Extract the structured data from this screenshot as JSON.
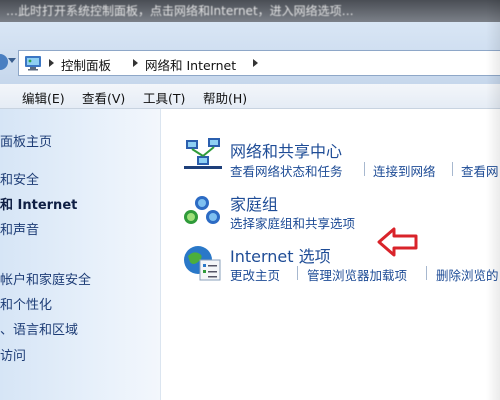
{
  "top_strip": {
    "text": "…此时打开系统控制面板，点击网络和Internet，进入网络选项…"
  },
  "address_bar": {
    "crumbs": [
      "控制面板",
      "网络和 Internet"
    ]
  },
  "menu": {
    "items": [
      "编辑(E)",
      "查看(V)",
      "工具(T)",
      "帮助(H)"
    ]
  },
  "left_nav": {
    "items": [
      "面板主页",
      "和安全",
      "和 Internet",
      "和声音",
      "帐户和家庭安全",
      "和个性化",
      "、语言和区域",
      "访问"
    ]
  },
  "categories": [
    {
      "title": "网络和共享中心",
      "links": [
        "查看网络状态和任务",
        "连接到网络",
        "查看网"
      ]
    },
    {
      "title": "家庭组",
      "links": [
        "选择家庭组和共享选项"
      ]
    },
    {
      "title": "Internet 选项",
      "links": [
        "更改主页",
        "管理浏览器加载项",
        "删除浏览的"
      ]
    }
  ],
  "colors": {
    "link": "#1e4c96",
    "annotation_arrow": "#d9232a"
  },
  "icons": {
    "control_panel": "control-panel-icon",
    "network_sharing": "network-sharing-center-icon",
    "homegroup": "homegroup-icon",
    "internet_options": "internet-options-icon",
    "annotation": "red-arrow-annotation-icon"
  }
}
